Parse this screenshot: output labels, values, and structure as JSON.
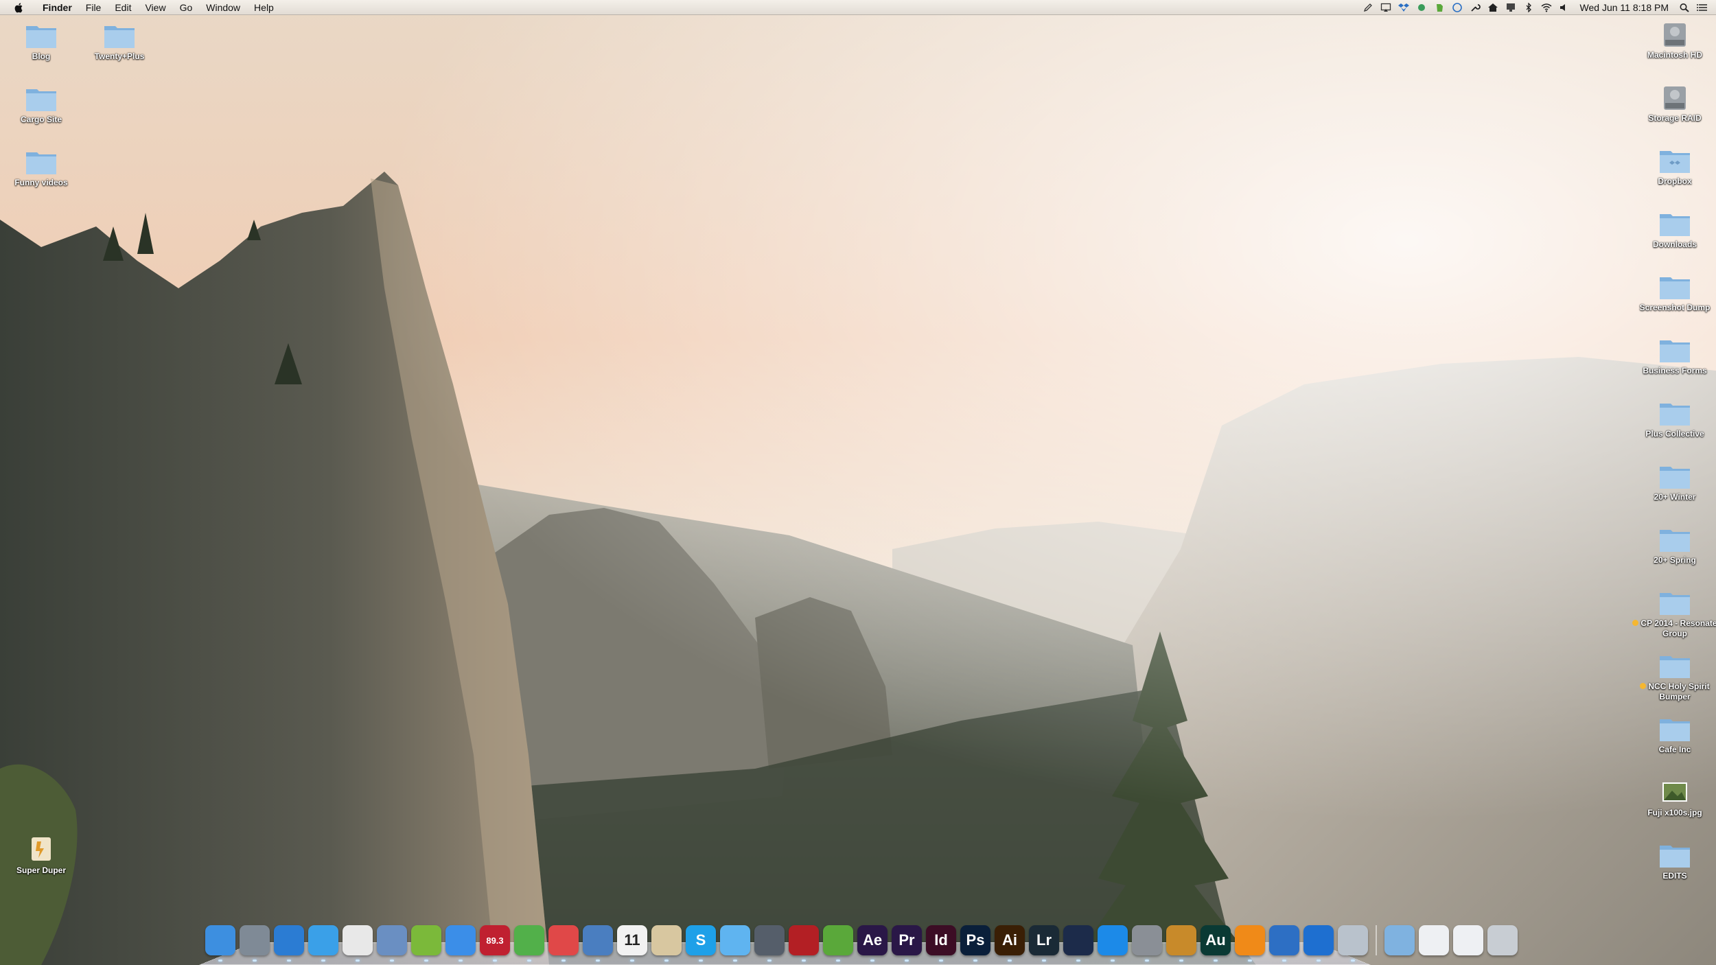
{
  "menubar": {
    "app_name": "Finder",
    "menus": [
      "File",
      "Edit",
      "View",
      "Go",
      "Window",
      "Help"
    ],
    "clock": "Wed Jun 11  8:18 PM",
    "status_icons": [
      "pencil-icon",
      "airplay-icon",
      "dropbox-icon",
      "cloud-sync-icon",
      "evernote-icon",
      "app-icon",
      "wrench-icon",
      "home-icon",
      "display-icon",
      "bluetooth-icon",
      "wifi-icon",
      "volume-icon",
      "spotlight-icon",
      "notifications-icon"
    ]
  },
  "desktop": {
    "left_icons": [
      {
        "label": "Blog"
      },
      {
        "label": "Twenty+Plus"
      },
      {
        "label": "Cargo Site"
      },
      {
        "label": "Funny videos"
      },
      {
        "label": "Super Duper"
      }
    ],
    "right_icons": [
      {
        "label": "Macintosh HD",
        "kind": "drive"
      },
      {
        "label": "Storage RAID",
        "kind": "drive"
      },
      {
        "label": "Dropbox",
        "kind": "folder"
      },
      {
        "label": "Downloads",
        "kind": "folder"
      },
      {
        "label": "Screenshot Dump",
        "kind": "folder"
      },
      {
        "label": "Business Forms",
        "kind": "folder"
      },
      {
        "label": "Plus Collective",
        "kind": "folder"
      },
      {
        "label": "20+ Winter",
        "kind": "folder"
      },
      {
        "label": "20+ Spring",
        "kind": "folder"
      },
      {
        "label": "CP 2014 - Resonate Group",
        "kind": "folder",
        "tag": "orange"
      },
      {
        "label": "NCC Holy Spirit Bumper",
        "kind": "folder",
        "tag": "orange"
      },
      {
        "label": "Cafe Inc",
        "kind": "folder"
      },
      {
        "label": "Fuji x100s.jpg",
        "kind": "image"
      },
      {
        "label": "EDITS",
        "kind": "folder"
      }
    ]
  },
  "dock": {
    "apps": [
      {
        "name": "finder-icon",
        "text": "",
        "color": "#3d8fe0"
      },
      {
        "name": "launchpad-icon",
        "text": "",
        "color": "#7f8a96"
      },
      {
        "name": "tweetbot-icon",
        "text": "",
        "color": "#2b7cd3"
      },
      {
        "name": "safari-icon",
        "text": "",
        "color": "#3aa0e8"
      },
      {
        "name": "chrome-icon",
        "text": "",
        "color": "#e8e8e8"
      },
      {
        "name": "preview-icon",
        "text": "",
        "color": "#6a8fc2"
      },
      {
        "name": "spotify-icon",
        "text": "",
        "color": "#7bb93a"
      },
      {
        "name": "itunes-icon",
        "text": "",
        "color": "#3b8ee8"
      },
      {
        "name": "radio-icon",
        "text": "89.3",
        "color": "#c02030"
      },
      {
        "name": "evernote-icon",
        "text": "",
        "color": "#52b04a"
      },
      {
        "name": "wunderlist-icon",
        "text": "",
        "color": "#e04848"
      },
      {
        "name": "disk-utility-icon",
        "text": "",
        "color": "#4a7ec0"
      },
      {
        "name": "calendar-icon",
        "text": "11",
        "color": "#f2f2f2"
      },
      {
        "name": "photo-viewer-icon",
        "text": "",
        "color": "#d8c7a0"
      },
      {
        "name": "skype-icon",
        "text": "S",
        "color": "#1ea0e8"
      },
      {
        "name": "messages-icon",
        "text": "",
        "color": "#5fb4f0"
      },
      {
        "name": "facetime-icon",
        "text": "",
        "color": "#555e6a"
      },
      {
        "name": "photo-booth-icon",
        "text": "",
        "color": "#b31f24"
      },
      {
        "name": "leaf-app-icon",
        "text": "",
        "color": "#5aa83a"
      },
      {
        "name": "after-effects-icon",
        "text": "Ae",
        "color": "#2a1747"
      },
      {
        "name": "premiere-icon",
        "text": "Pr",
        "color": "#2a1747"
      },
      {
        "name": "indesign-icon",
        "text": "Id",
        "color": "#3c0d25"
      },
      {
        "name": "photoshop-icon",
        "text": "Ps",
        "color": "#0a1f3a"
      },
      {
        "name": "illustrator-icon",
        "text": "Ai",
        "color": "#3a1f05"
      },
      {
        "name": "lightroom-icon",
        "text": "Lr",
        "color": "#1a2a36"
      },
      {
        "name": "cinema4d-icon",
        "text": "",
        "color": "#1c2b4a"
      },
      {
        "name": "app-store-icon",
        "text": "",
        "color": "#1c8ae8"
      },
      {
        "name": "system-preferences-icon",
        "text": "",
        "color": "#8a8f96"
      },
      {
        "name": "cocktail-icon",
        "text": "",
        "color": "#c88a2a"
      },
      {
        "name": "audition-icon",
        "text": "Au",
        "color": "#0a3a34"
      },
      {
        "name": "vlc-icon",
        "text": "",
        "color": "#f08a18"
      },
      {
        "name": "quicktime-icon",
        "text": "",
        "color": "#2d6fc4"
      },
      {
        "name": "teamviewer-icon",
        "text": "",
        "color": "#1e6fd0"
      },
      {
        "name": "screenshot-icon",
        "text": "",
        "color": "#b9c2cc"
      }
    ],
    "right_items": [
      {
        "name": "applications-folder-icon",
        "color": "#7fb2e0"
      },
      {
        "name": "documents-stack-icon",
        "color": "#eef0f3"
      },
      {
        "name": "downloads-stack-icon",
        "color": "#eef0f3"
      },
      {
        "name": "trash-icon",
        "color": "#c8cdd3"
      }
    ]
  }
}
